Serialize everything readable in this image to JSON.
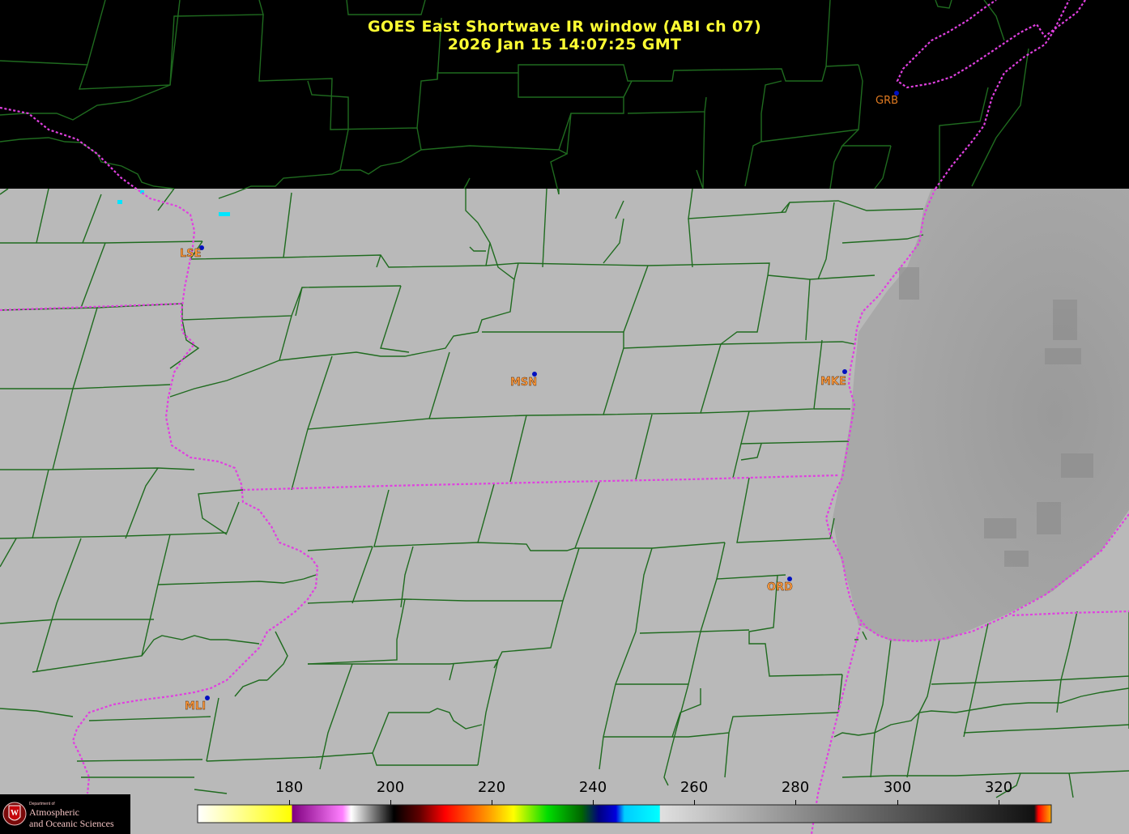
{
  "title": {
    "line1": "GOES East Shortwave IR window (ABI ch 07)",
    "line2": "2026 Jan 15  14:07:25 GMT"
  },
  "stations": [
    {
      "code": "GRB"
    },
    {
      "code": "LSE"
    },
    {
      "code": "MSN"
    },
    {
      "code": "MKE"
    },
    {
      "code": "ORD"
    },
    {
      "code": "MLI"
    }
  ],
  "colorbar": {
    "ticks": [
      "180",
      "200",
      "220",
      "240",
      "260",
      "280",
      "300",
      "320"
    ]
  },
  "logo": {
    "dept": "Department of",
    "line1": "Atmospheric",
    "line2": "and Oceanic Sciences"
  },
  "colors": {
    "title": "#ffff33",
    "county_lines": "#1f6b1f",
    "state_lines": "#e040e0",
    "land": "#b9b9b9",
    "lake": "#9a9a9a",
    "labels": "#ff9a3c"
  }
}
